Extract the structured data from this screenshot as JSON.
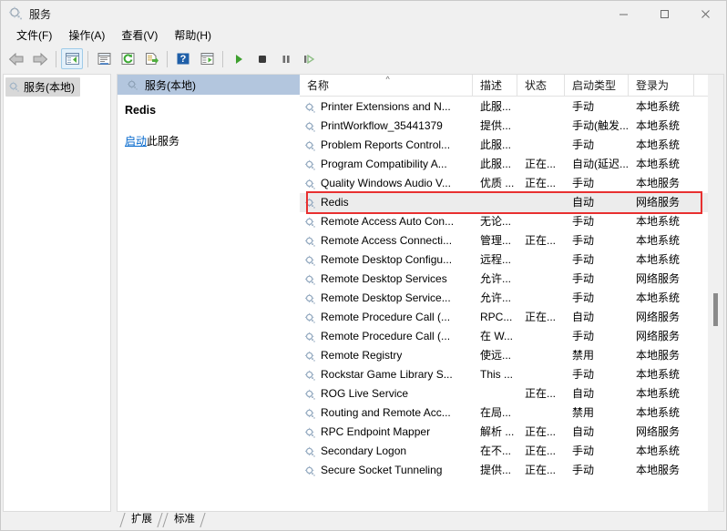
{
  "window": {
    "title": "服务",
    "icon": "services-gear-icon",
    "minimize_label": "最小化",
    "maximize_label": "最大化",
    "close_label": "关闭"
  },
  "menubar": {
    "items": [
      {
        "label": "文件(F)",
        "name": "menu-file"
      },
      {
        "label": "操作(A)",
        "name": "menu-action"
      },
      {
        "label": "查看(V)",
        "name": "menu-view"
      },
      {
        "label": "帮助(H)",
        "name": "menu-help"
      }
    ]
  },
  "toolbar": {
    "buttons": [
      {
        "icon": "back-arrow-icon",
        "name": "toolbar-back",
        "active": false
      },
      {
        "icon": "forward-arrow-icon",
        "name": "toolbar-forward",
        "active": false
      },
      {
        "icon": "show-hide-console-tree-icon",
        "name": "toolbar-show-tree",
        "active": true
      },
      {
        "icon": "properties-icon",
        "name": "toolbar-properties",
        "active": false
      },
      {
        "icon": "refresh-icon",
        "name": "toolbar-refresh",
        "active": false
      },
      {
        "icon": "export-list-icon",
        "name": "toolbar-export-list",
        "active": false
      },
      {
        "icon": "help-icon",
        "name": "toolbar-help",
        "active": false
      },
      {
        "icon": "show-action-pane-icon",
        "name": "toolbar-action-pane",
        "active": false
      },
      {
        "icon": "start-service-icon",
        "name": "toolbar-start-service",
        "active": false
      },
      {
        "icon": "stop-service-icon",
        "name": "toolbar-stop-service",
        "active": false
      },
      {
        "icon": "pause-service-icon",
        "name": "toolbar-pause-service",
        "active": false
      },
      {
        "icon": "restart-service-icon",
        "name": "toolbar-restart-service",
        "active": false
      }
    ]
  },
  "tree": {
    "root_label": "服务(本地)",
    "root_icon": "services-gear-icon"
  },
  "details": {
    "header_label": "服务(本地)",
    "header_icon": "services-gear-icon",
    "service_name": "Redis",
    "action_link": "启动",
    "action_suffix": "此服务"
  },
  "list": {
    "columns": [
      {
        "label": "名称",
        "name": "column-name",
        "sorted": true,
        "sort_mark": "^"
      },
      {
        "label": "描述",
        "name": "column-description",
        "sorted": false,
        "sort_mark": ""
      },
      {
        "label": "状态",
        "name": "column-status",
        "sorted": false,
        "sort_mark": ""
      },
      {
        "label": "启动类型",
        "name": "column-startup-type",
        "sorted": false,
        "sort_mark": ""
      },
      {
        "label": "登录为",
        "name": "column-log-on-as",
        "sorted": false,
        "sort_mark": ""
      }
    ],
    "rows": [
      {
        "name": "Printer Extensions and N...",
        "desc": "此服...",
        "status": "",
        "startup": "手动",
        "logon": "本地系统",
        "selected": false
      },
      {
        "name": "PrintWorkflow_35441379",
        "desc": "提供...",
        "status": "",
        "startup": "手动(触发...",
        "logon": "本地系统",
        "selected": false
      },
      {
        "name": "Problem Reports Control...",
        "desc": "此服...",
        "status": "",
        "startup": "手动",
        "logon": "本地系统",
        "selected": false
      },
      {
        "name": "Program Compatibility A...",
        "desc": "此服...",
        "status": "正在...",
        "startup": "自动(延迟...",
        "logon": "本地系统",
        "selected": false
      },
      {
        "name": "Quality Windows Audio V...",
        "desc": "优质 ...",
        "status": "正在...",
        "startup": "手动",
        "logon": "本地服务",
        "selected": false
      },
      {
        "name": "Redis",
        "desc": "",
        "status": "",
        "startup": "自动",
        "logon": "网络服务",
        "selected": true
      },
      {
        "name": "Remote Access Auto Con...",
        "desc": "无论...",
        "status": "",
        "startup": "手动",
        "logon": "本地系统",
        "selected": false
      },
      {
        "name": "Remote Access Connecti...",
        "desc": "管理...",
        "status": "正在...",
        "startup": "手动",
        "logon": "本地系统",
        "selected": false
      },
      {
        "name": "Remote Desktop Configu...",
        "desc": "远程...",
        "status": "",
        "startup": "手动",
        "logon": "本地系统",
        "selected": false
      },
      {
        "name": "Remote Desktop Services",
        "desc": "允许...",
        "status": "",
        "startup": "手动",
        "logon": "网络服务",
        "selected": false
      },
      {
        "name": "Remote Desktop Service...",
        "desc": "允许...",
        "status": "",
        "startup": "手动",
        "logon": "本地系统",
        "selected": false
      },
      {
        "name": "Remote Procedure Call (...",
        "desc": "RPC...",
        "status": "正在...",
        "startup": "自动",
        "logon": "网络服务",
        "selected": false
      },
      {
        "name": "Remote Procedure Call (...",
        "desc": "在 W...",
        "status": "",
        "startup": "手动",
        "logon": "网络服务",
        "selected": false
      },
      {
        "name": "Remote Registry",
        "desc": "使远...",
        "status": "",
        "startup": "禁用",
        "logon": "本地服务",
        "selected": false
      },
      {
        "name": "Rockstar Game Library S...",
        "desc": "This ...",
        "status": "",
        "startup": "手动",
        "logon": "本地系统",
        "selected": false
      },
      {
        "name": "ROG Live Service",
        "desc": "",
        "status": "正在...",
        "startup": "自动",
        "logon": "本地系统",
        "selected": false
      },
      {
        "name": "Routing and Remote Acc...",
        "desc": "在局...",
        "status": "",
        "startup": "禁用",
        "logon": "本地系统",
        "selected": false
      },
      {
        "name": "RPC Endpoint Mapper",
        "desc": "解析 ...",
        "status": "正在...",
        "startup": "自动",
        "logon": "网络服务",
        "selected": false
      },
      {
        "name": "Secondary Logon",
        "desc": "在不...",
        "status": "正在...",
        "startup": "手动",
        "logon": "本地系统",
        "selected": false
      },
      {
        "name": "Secure Socket Tunneling",
        "desc": "提供...",
        "status": "正在...",
        "startup": "手动",
        "logon": "本地服务",
        "selected": false
      }
    ]
  },
  "tabs": [
    {
      "label": "扩展",
      "name": "tab-extended"
    },
    {
      "label": "标准",
      "name": "tab-standard"
    }
  ],
  "annotation": {
    "color": "#e83030",
    "target_row": "Redis"
  }
}
